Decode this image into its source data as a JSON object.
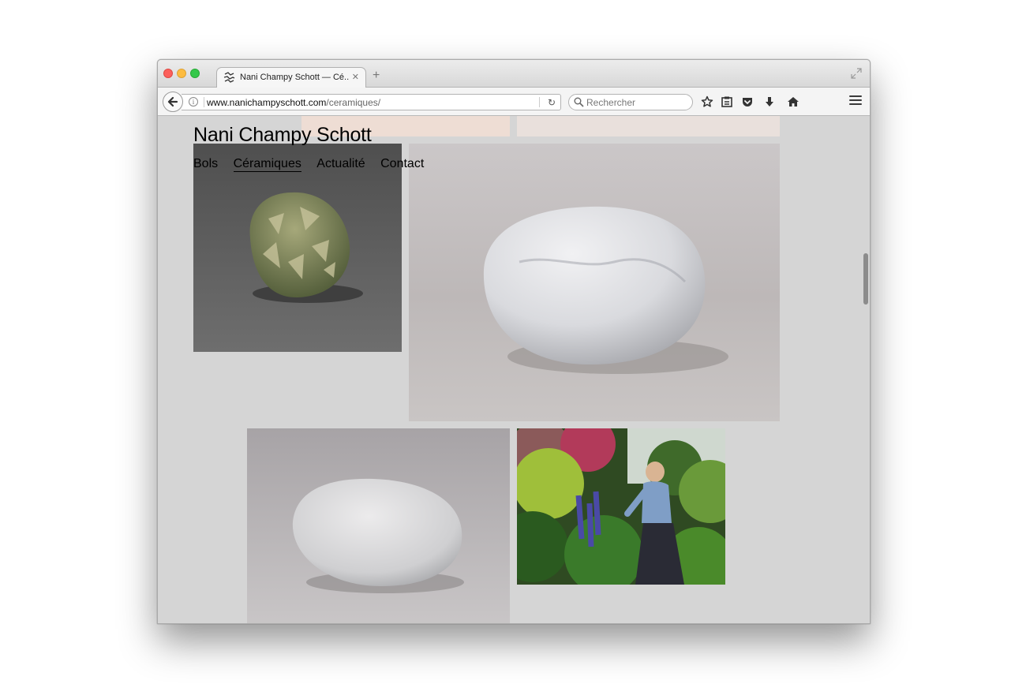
{
  "browser": {
    "tab": {
      "title": "Nani Champy Schott — Cé..."
    },
    "address": {
      "domain": "www.nanichampyschott.com",
      "path": "/ceramiques/"
    },
    "search": {
      "placeholder": "Rechercher"
    }
  },
  "site": {
    "title": "Nani Champy Schott",
    "nav": [
      {
        "label": "Bols",
        "active": false
      },
      {
        "label": "Céramiques",
        "active": true
      },
      {
        "label": "Actualité",
        "active": false
      },
      {
        "label": "Contact",
        "active": false
      }
    ]
  },
  "gallery": {
    "images": [
      {
        "subject": "green-speckled-stone-ceramic"
      },
      {
        "subject": "large-white-stone-ceramic"
      },
      {
        "subject": "white-stone-ceramic"
      },
      {
        "subject": "artist-in-garden"
      }
    ]
  },
  "colors": {
    "page_background": "#d5d5d5",
    "text": "#000000"
  },
  "icons": [
    "back-arrow-icon",
    "info-icon",
    "reload-icon",
    "search-icon",
    "bookmark-star-icon",
    "reading-list-icon",
    "pocket-icon",
    "download-icon",
    "home-icon",
    "menu-icon",
    "fullscreen-icon",
    "new-tab-icon",
    "tab-close-icon"
  ]
}
